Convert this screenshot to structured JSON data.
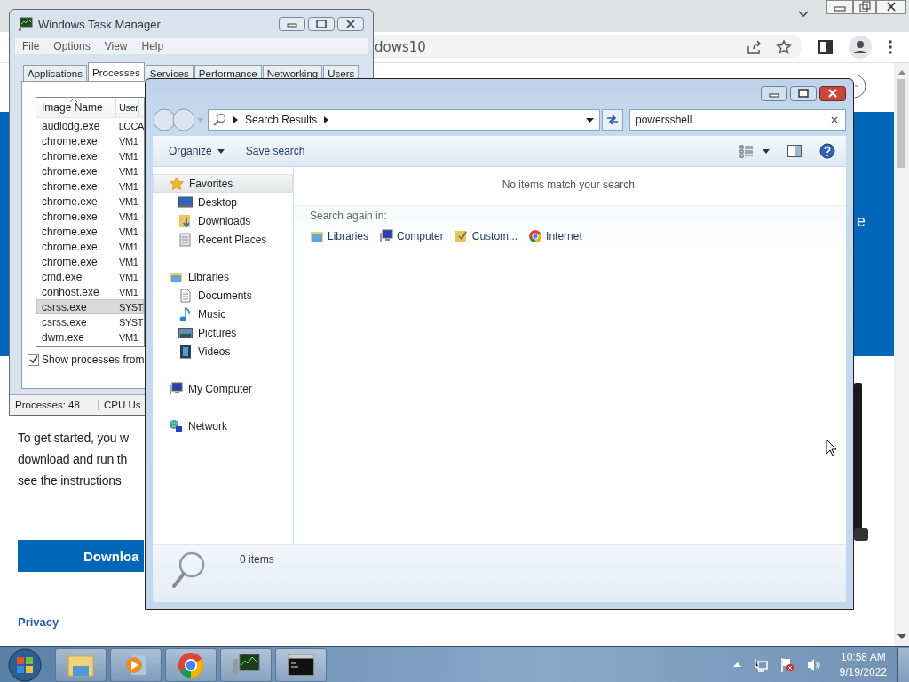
{
  "browser": {
    "address_text": "dows10",
    "side_letter": "e",
    "paragraph_lines": [
      "To get started, you w",
      "download and run th",
      "see the instructions"
    ],
    "download_button": "Downloa",
    "privacy_link": "Privacy"
  },
  "task_manager": {
    "title": "Windows Task Manager",
    "menu": [
      "File",
      "Options",
      "View",
      "Help"
    ],
    "tabs": [
      {
        "label": "Applications",
        "selected": false
      },
      {
        "label": "Processes",
        "selected": true
      },
      {
        "label": "Services",
        "selected": false
      },
      {
        "label": "Performance",
        "selected": false
      },
      {
        "label": "Networking",
        "selected": false
      },
      {
        "label": "Users",
        "selected": false
      }
    ],
    "columns": [
      "Image Name",
      "User"
    ],
    "rows": [
      {
        "image": "audiodg.exe",
        "user": "LOCA",
        "selected": false
      },
      {
        "image": "chrome.exe",
        "user": "VM1",
        "selected": false
      },
      {
        "image": "chrome.exe",
        "user": "VM1",
        "selected": false
      },
      {
        "image": "chrome.exe",
        "user": "VM1",
        "selected": false
      },
      {
        "image": "chrome.exe",
        "user": "VM1",
        "selected": false
      },
      {
        "image": "chrome.exe",
        "user": "VM1",
        "selected": false
      },
      {
        "image": "chrome.exe",
        "user": "VM1",
        "selected": false
      },
      {
        "image": "chrome.exe",
        "user": "VM1",
        "selected": false
      },
      {
        "image": "chrome.exe",
        "user": "VM1",
        "selected": false
      },
      {
        "image": "chrome.exe",
        "user": "VM1",
        "selected": false
      },
      {
        "image": "cmd.exe",
        "user": "VM1",
        "selected": false
      },
      {
        "image": "conhost.exe",
        "user": "VM1",
        "selected": false
      },
      {
        "image": "csrss.exe",
        "user": "SYST",
        "selected": true
      },
      {
        "image": "csrss.exe",
        "user": "SYST",
        "selected": false
      },
      {
        "image": "dwm.exe",
        "user": "VM1",
        "selected": false
      }
    ],
    "show_all": {
      "label": "Show processes from",
      "checked": true
    },
    "status": [
      "Processes: 48",
      "CPU Us"
    ]
  },
  "explorer": {
    "breadcrumb": "Search Results",
    "search": {
      "value": "powersshell"
    },
    "toolbar": [
      "Organize",
      "Save search"
    ],
    "nav": [
      {
        "label": "Favorites",
        "kind": "star",
        "selected": true,
        "children": [
          {
            "label": "Desktop",
            "kind": "desktop",
            "selected": false
          },
          {
            "label": "Downloads",
            "kind": "downloads",
            "selected": false
          },
          {
            "label": "Recent Places",
            "kind": "recent",
            "selected": false
          }
        ]
      },
      {
        "label": "Libraries",
        "kind": "library",
        "selected": false,
        "children": [
          {
            "label": "Documents",
            "kind": "document",
            "selected": false
          },
          {
            "label": "Music",
            "kind": "music",
            "selected": false
          },
          {
            "label": "Pictures",
            "kind": "pictures",
            "selected": false
          },
          {
            "label": "Videos",
            "kind": "videos",
            "selected": false
          }
        ]
      },
      {
        "label": "My Computer",
        "kind": "computer",
        "selected": false
      },
      {
        "label": "Network",
        "kind": "network",
        "selected": false
      }
    ],
    "message": "No items match your search.",
    "search_again_label": "Search again in:",
    "search_again": [
      {
        "label": "Libraries",
        "kind": "library"
      },
      {
        "label": "Computer",
        "kind": "computer"
      },
      {
        "label": "Custom...",
        "kind": "custom"
      },
      {
        "label": "Internet",
        "kind": "internet"
      }
    ],
    "status": "0 items"
  },
  "taskbar": {
    "apps": [
      {
        "kind": "explorer"
      },
      {
        "kind": "media"
      },
      {
        "kind": "chrome"
      },
      {
        "kind": "taskmgr"
      },
      {
        "kind": "cmd"
      }
    ],
    "time": "10:58 AM",
    "date": "9/19/2022"
  }
}
